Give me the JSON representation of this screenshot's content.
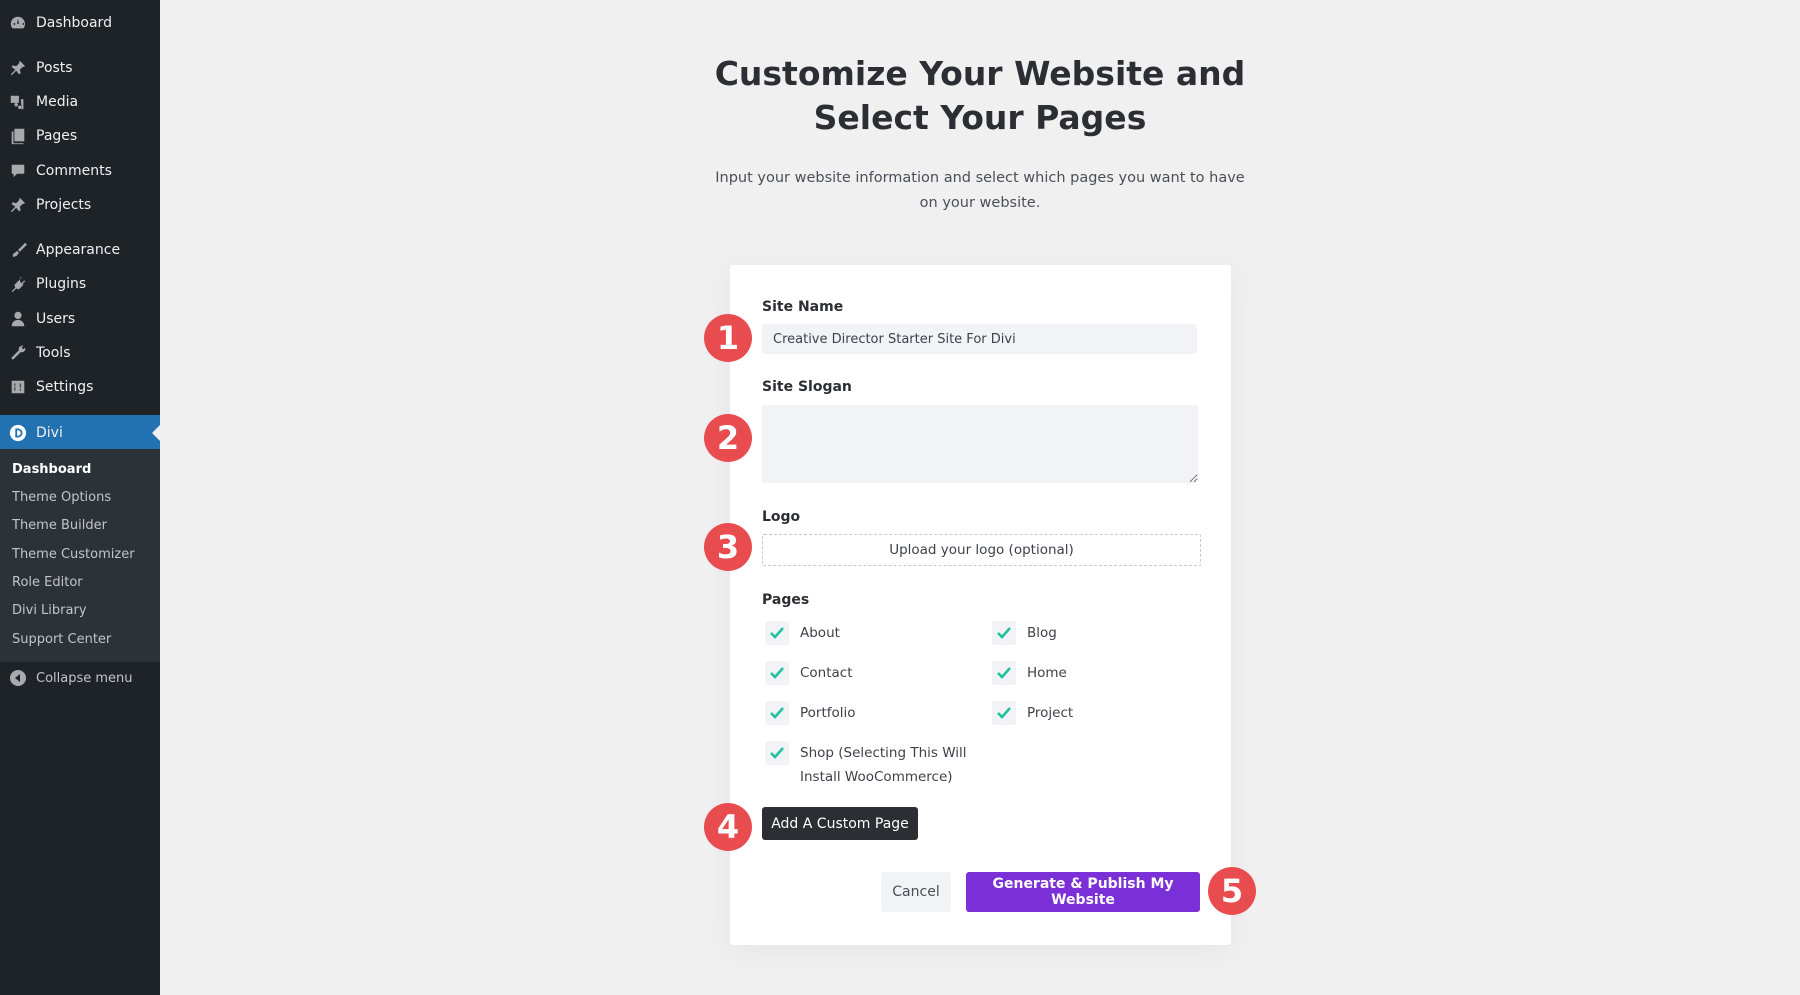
{
  "sidebar": {
    "items": [
      {
        "label": "Dashboard",
        "icon": "dashboard-icon"
      },
      {
        "label": "Posts",
        "icon": "pin-icon"
      },
      {
        "label": "Media",
        "icon": "media-icon"
      },
      {
        "label": "Pages",
        "icon": "pages-icon"
      },
      {
        "label": "Comments",
        "icon": "comment-icon"
      },
      {
        "label": "Projects",
        "icon": "pin-icon"
      },
      {
        "label": "Appearance",
        "icon": "brush-icon"
      },
      {
        "label": "Plugins",
        "icon": "plugin-icon"
      },
      {
        "label": "Users",
        "icon": "user-icon"
      },
      {
        "label": "Tools",
        "icon": "wrench-icon"
      },
      {
        "label": "Settings",
        "icon": "settings-icon"
      },
      {
        "label": "Divi",
        "icon": "divi-logo-icon",
        "active": true
      }
    ],
    "submenu": [
      {
        "label": "Dashboard",
        "current": true
      },
      {
        "label": "Theme Options"
      },
      {
        "label": "Theme Builder"
      },
      {
        "label": "Theme Customizer"
      },
      {
        "label": "Role Editor"
      },
      {
        "label": "Divi Library"
      },
      {
        "label": "Support Center"
      }
    ],
    "collapse_label": "Collapse menu"
  },
  "main": {
    "title_line1": "Customize Your Website and",
    "title_line2": "Select Your Pages",
    "subtitle_line1": "Input your website information and select which pages you want to have",
    "subtitle_line2": "on your website."
  },
  "form": {
    "site_name_label": "Site Name",
    "site_name_value": "Creative Director Starter Site For Divi",
    "site_slogan_label": "Site Slogan",
    "site_slogan_value": "",
    "logo_label": "Logo",
    "logo_upload_label": "Upload your logo (optional)",
    "pages_label": "Pages",
    "pages": [
      {
        "label": "About",
        "checked": true
      },
      {
        "label": "Blog",
        "checked": true
      },
      {
        "label": "Contact",
        "checked": true
      },
      {
        "label": "Home",
        "checked": true
      },
      {
        "label": "Portfolio",
        "checked": true
      },
      {
        "label": "Project",
        "checked": true
      },
      {
        "label": "Shop (Selecting This Will Install WooCommerce)",
        "label_line1": "Shop (Selecting This Will",
        "label_line2": "Install WooCommerce)",
        "checked": true
      }
    ],
    "add_custom_page_label": "Add A Custom Page",
    "cancel_label": "Cancel",
    "publish_label": "Generate & Publish My Website"
  },
  "steps": [
    "1",
    "2",
    "3",
    "4",
    "5"
  ],
  "colors": {
    "sidebar_bg": "#1d2327",
    "sidebar_active": "#2271b1",
    "accent_purple": "#7b2fd6",
    "check_green": "#1fbf9f",
    "step_red": "#e84c4f",
    "page_bg": "#f0f0f1"
  }
}
